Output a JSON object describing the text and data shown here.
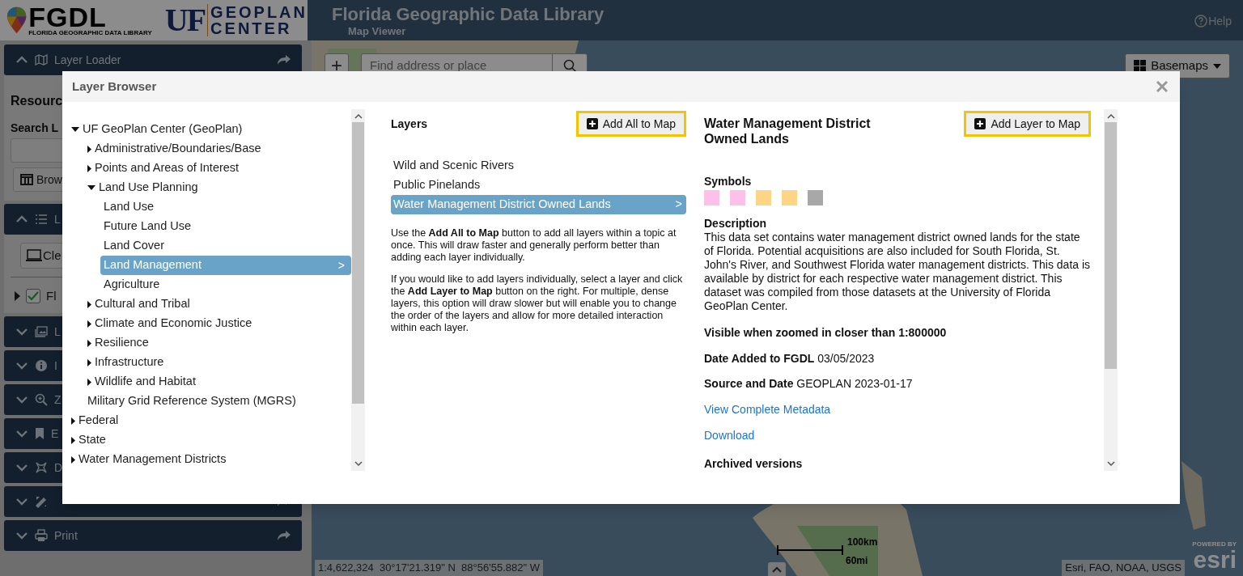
{
  "header": {
    "logo_text": "FGDL",
    "logo_subtitle": "FLORIDA GEOGRAPHIC DATA LIBRARY",
    "partner_mark": "UF",
    "partner_words": [
      "GEOPLAN",
      "CENTER"
    ],
    "title": "Florida Geographic Data Library",
    "subtitle": "Map Viewer",
    "help": "Help"
  },
  "sidebar": {
    "panels": [
      {
        "title": "Layer Loader",
        "expanded": true
      },
      {
        "title": "L",
        "expanded": true
      },
      {
        "title": "L",
        "expanded": false
      },
      {
        "title": "I",
        "expanded": false
      },
      {
        "title": "Z",
        "expanded": false
      },
      {
        "title": "E",
        "expanded": false
      },
      {
        "title": "D",
        "expanded": false
      },
      {
        "expanded": false
      },
      {
        "title": "Print",
        "expanded": false
      }
    ],
    "loader": {
      "heading": "Resourc",
      "search_label": "Search L",
      "browse_button": "Brow"
    },
    "layers": {
      "clear_button": "Cle",
      "rows": [
        {
          "label": "Fl",
          "checked": true
        }
      ]
    }
  },
  "map": {
    "zoom_in": "+",
    "search": {
      "placeholder": "Find address or place"
    },
    "basemaps": "Basemaps",
    "scale": [
      "100km",
      "60mi"
    ],
    "coordinates": "1:4,622,324  30°17'21.319\" N  88°56'55.882\" W",
    "attribution": "Esri, FAO, NOAA, USGS",
    "esri_tagline": "POWERED BY",
    "esri_logo": "esri"
  },
  "modal": {
    "title": "Layer Browser",
    "tree": [
      {
        "label": "UF GeoPlan Center (GeoPlan)",
        "kind": "folder",
        "expanded": true,
        "selected": false,
        "children": [
          {
            "label": "Administrative/Boundaries/Base",
            "kind": "folder",
            "expanded": false,
            "selected": false
          },
          {
            "label": "Points and Areas of Interest",
            "kind": "folder",
            "expanded": false,
            "selected": false
          },
          {
            "label": "Land Use Planning",
            "kind": "folder",
            "expanded": true,
            "selected": false,
            "children": [
              {
                "label": "Land Use",
                "kind": "leaf",
                "selected": false
              },
              {
                "label": "Future Land Use",
                "kind": "leaf",
                "selected": false
              },
              {
                "label": "Land Cover",
                "kind": "leaf",
                "selected": false
              },
              {
                "label": "Land Management",
                "kind": "leaf",
                "selected": true,
                "marker": ">"
              },
              {
                "label": "Agriculture",
                "kind": "leaf",
                "selected": false
              }
            ]
          },
          {
            "label": "Cultural and Tribal",
            "kind": "folder",
            "expanded": false,
            "selected": false
          },
          {
            "label": "Climate and Economic Justice",
            "kind": "folder",
            "expanded": false,
            "selected": false
          },
          {
            "label": "Resilience",
            "kind": "folder",
            "expanded": false,
            "selected": false
          },
          {
            "label": "Infrastructure",
            "kind": "folder",
            "expanded": false,
            "selected": false
          },
          {
            "label": "Wildlife and Habitat",
            "kind": "folder",
            "expanded": false,
            "selected": false
          },
          {
            "label": "Military Grid Reference System (MGRS)",
            "kind": "leaf",
            "selected": false
          }
        ]
      },
      {
        "label": "Federal",
        "kind": "folder",
        "expanded": false,
        "selected": false
      },
      {
        "label": "State",
        "kind": "folder",
        "expanded": false,
        "selected": false
      },
      {
        "label": "Water Management Districts",
        "kind": "folder",
        "expanded": false,
        "selected": false
      }
    ],
    "layers": {
      "heading": "Layers",
      "add_all": "Add All to Map",
      "items": [
        {
          "label": "Wild and Scenic Rivers",
          "selected": false
        },
        {
          "label": "Public Pinelands",
          "selected": false
        },
        {
          "label": "Water Management District Owned Lands",
          "selected": true,
          "marker": ">"
        }
      ],
      "help": [
        "Use the **Add All to Map** button to add all layers within a topic at once. This will draw faster and generally perform better than adding each layer individually.",
        "If you would like to add layers individually, select a layer and click the **Add Layer to Map** button on the right. For multiple, dense layers, this option will draw slower but will enable you to change the order of the layers and allow for more detailed interaction within each layer."
      ]
    },
    "details": {
      "title": "Water Management District Owned Lands",
      "add_layer": "Add Layer to Map",
      "symbols_heading": "Symbols",
      "symbols": [
        {
          "color": "#fdc0e8"
        },
        {
          "color": "#fdc0e8"
        },
        {
          "color": "#fdd584"
        },
        {
          "color": "#fdd584"
        },
        {
          "color": "#a8a8a8"
        }
      ],
      "description_heading": "Description",
      "description": "This data set contains water management district owned lands for the state of Florida. Potential acquisitions are also included for South Florida, St. John's River, and Southwest Florida water management districts. This data is available by district for each respective water management district. This dataset was compiled from those datasets at the University of Florida GeoPlan Center.",
      "visibility": "Visible when zoomed in closer than 1:800000",
      "date_added": "**Date Added to FGDL** 03/05/2023",
      "source": "**Source and Date** GEOPLAN 2023-01-17",
      "links": [
        "View Complete Metadata",
        "Download"
      ],
      "archived_heading": "Archived versions"
    }
  }
}
